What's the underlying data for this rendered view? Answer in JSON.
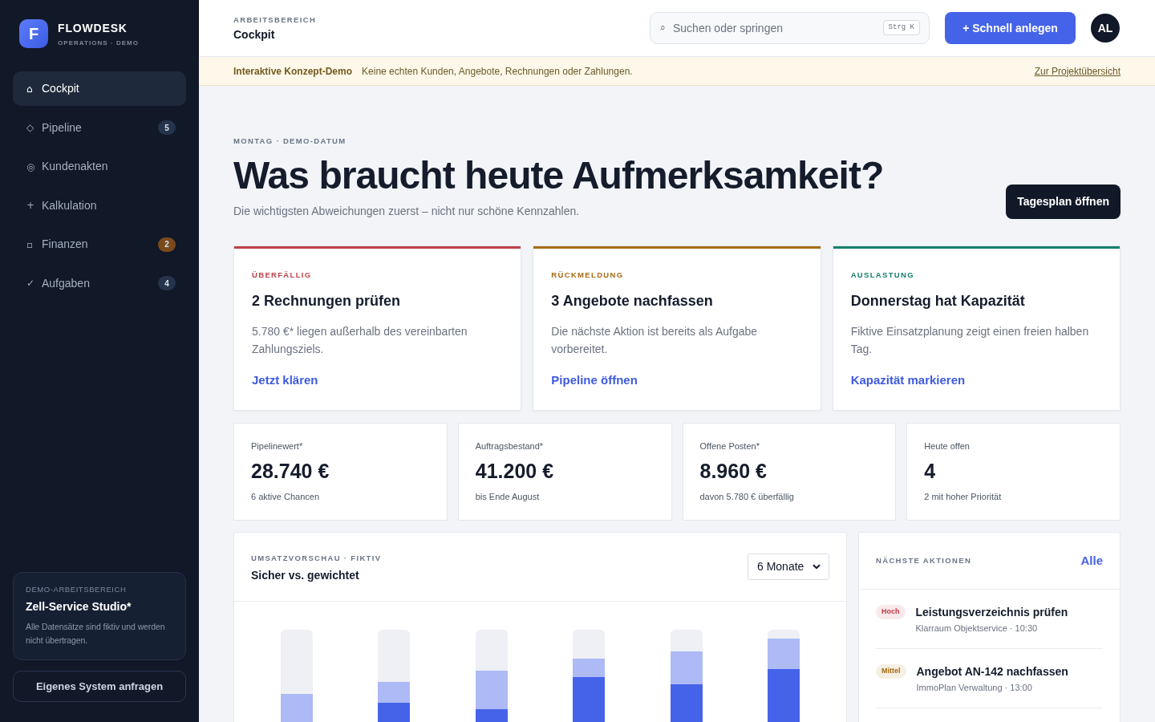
{
  "sidebar": {
    "brand": {
      "logo_letter": "F",
      "name": "FLOWDESK",
      "tagline": "OPERATIONS · DEMO"
    },
    "nav": [
      {
        "icon": "⌂",
        "label": "Cockpit",
        "selected": true
      },
      {
        "icon": "◇",
        "label": "Pipeline",
        "selected": false,
        "badge": {
          "text": "5",
          "color": "#26344b"
        }
      },
      {
        "icon": "◎",
        "label": "Kundenakten",
        "selected": false
      },
      {
        "icon": "+",
        "label": "Kalkulation",
        "selected": false
      },
      {
        "icon": "▫",
        "label": "Finanzen",
        "selected": false,
        "badge": {
          "text": "2",
          "color": "#7a4a1d"
        }
      },
      {
        "icon": "✓",
        "label": "Aufgaben",
        "selected": false,
        "badge": {
          "text": "4",
          "color": "#26344b"
        }
      }
    ],
    "workspace": {
      "kicker": "DEMO-ARBEITSBEREICH",
      "name": "Zell-Service Studio*",
      "note": "Alle Datensätze sind fiktiv und werden nicht übertragen."
    },
    "request_button": "Eigenes System anfragen"
  },
  "header": {
    "kicker": "ARBEITSBEREICH",
    "title": "Cockpit",
    "search": {
      "icon": "⌕",
      "placeholder": "Suchen oder springen",
      "shortcut": "Strg K"
    },
    "create_button": "+ Schnell anlegen",
    "avatar": "AL"
  },
  "banner": {
    "title": "Interaktive Konzept-Demo",
    "text": "Keine echten Kunden, Angebote, Rechnungen oder Zahlungen.",
    "link": "Zur Projektübersicht"
  },
  "hero": {
    "kicker": "MONTAG · DEMO-DATUM",
    "title": "Was braucht heute Aufmerksamkeit?",
    "subtitle": "Die wichtigsten Abweichungen zuerst – nicht nur schöne Kennzahlen.",
    "button": "Tagesplan öffnen"
  },
  "alerts": [
    {
      "kicker": "ÜBERFÄLLIG",
      "color": "#c0404a",
      "title": "2 Rechnungen prüfen",
      "text": "5.780 €* liegen außerhalb des vereinbarten Zahlungsziels.",
      "link": "Jetzt klären"
    },
    {
      "kicker": "RÜCKMELDUNG",
      "color": "#a86a14",
      "title": "3 Angebote nachfassen",
      "text": "Die nächste Aktion ist bereits als Aufgabe vorbereitet.",
      "link": "Pipeline öffnen"
    },
    {
      "kicker": "AUSLASTUNG",
      "color": "#15806a",
      "title": "Donnerstag hat Kapazität",
      "text": "Fiktive Einsatzplanung zeigt einen freien halben Tag.",
      "link": "Kapazität markieren"
    }
  ],
  "kpis": [
    {
      "label": "Pipelinewert*",
      "value": "28.740 €",
      "note": "6 aktive Chancen"
    },
    {
      "label": "Auftragsbestand*",
      "value": "41.200 €",
      "note": "bis Ende August"
    },
    {
      "label": "Offene Posten*",
      "value": "8.960 €",
      "note": "davon 5.780 € überfällig"
    },
    {
      "label": "Heute offen",
      "value": "4",
      "note": "2 mit hoher Priorität"
    }
  ],
  "forecast": {
    "kicker": "UMSATZVORSCHAU · FIKTIV",
    "title": "Sicher vs. gewichtet",
    "period": "6 Monate"
  },
  "actions": {
    "kicker": "NÄCHSTE AKTIONEN",
    "link": "Alle",
    "items": [
      {
        "priority": {
          "label": "Hoch",
          "color": "#c23b4a"
        },
        "title": "Leistungsverzeichnis prüfen",
        "meta": "Klarraum Objektservice · 10:30"
      },
      {
        "priority": {
          "label": "Mittel",
          "color": "#a4690f"
        },
        "title": "Angebot AN-142 nachfassen",
        "meta": "ImmoPlan Verwaltung · 13:00"
      }
    ]
  }
}
